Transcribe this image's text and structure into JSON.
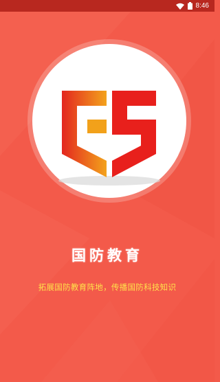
{
  "status_bar": {
    "time": "8:46",
    "icons": [
      "wifi-icon",
      "battery-icon"
    ]
  },
  "splash": {
    "logo_icon": "shield-g-logo-icon",
    "title": "国防教育",
    "slogan": "拓展国防教育阵地，传播国防科技知识"
  },
  "colors": {
    "background": "#f35a4a",
    "status_bar": "#b8281f",
    "logo_red": "#e8201c",
    "logo_orange": "#f2a11a",
    "slogan_text": "#ffe24a"
  }
}
